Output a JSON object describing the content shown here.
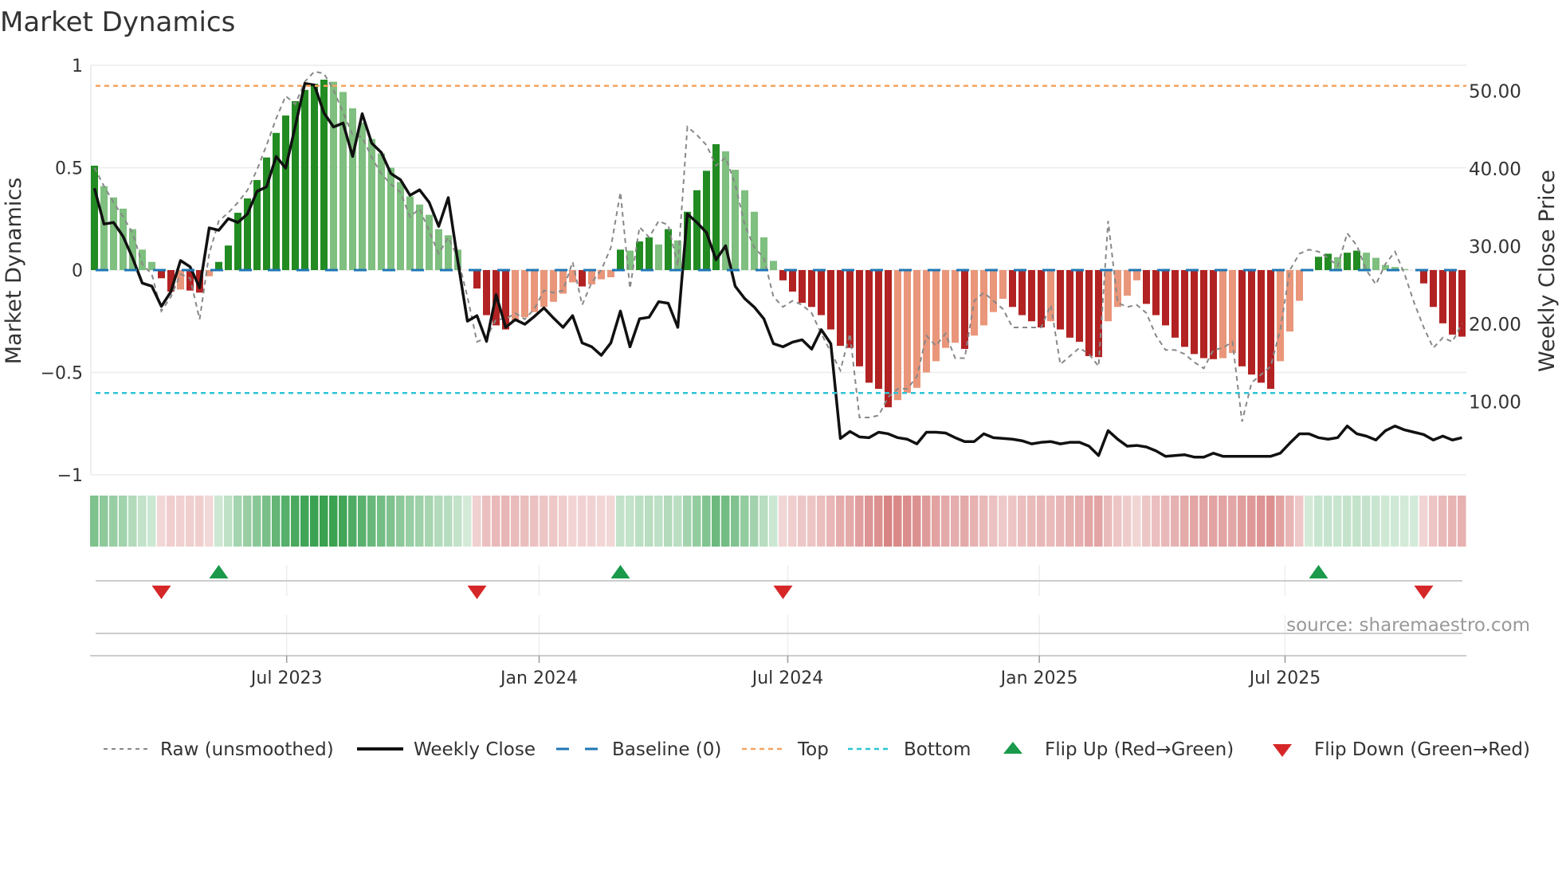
{
  "colors": {
    "pos_rising": "#228b22",
    "pos_falling": "#7fbf7f",
    "neg_falling": "#b22222",
    "neg_rising": "#e9967a",
    "close_line": "#111111",
    "raw_line": "#888888",
    "baseline": "#1f77b4",
    "top": "#f4a460",
    "bottom": "#2ec4d6",
    "flip_up": "#1a9a4a",
    "flip_down": "#d62728",
    "heat_green": "34,150,60",
    "heat_red": "200,80,80"
  },
  "chart_data": {
    "type": "bar",
    "title": "Market Dynamics",
    "ylabel": "Market Dynamics",
    "ylabel_right": "Weekly Close Price",
    "ylim": [
      -1,
      1
    ],
    "ylim_right_ref": [
      0,
      50
    ],
    "yticks": [
      {
        "value": 1,
        "label": "1"
      },
      {
        "value": 0.5,
        "label": "0.5"
      },
      {
        "value": 0,
        "label": "0"
      },
      {
        "value": -0.5,
        "label": "−0.5"
      },
      {
        "value": -1,
        "label": "−1"
      }
    ],
    "yticks_right": [
      {
        "value": 50,
        "label": "50.00"
      },
      {
        "value": 40,
        "label": "40.00"
      },
      {
        "value": 30,
        "label": "30.00"
      },
      {
        "value": 20,
        "label": "20.00"
      },
      {
        "value": 10,
        "label": "10.00"
      }
    ],
    "xticks": [
      {
        "week": 20.1,
        "label": "Jul 2023"
      },
      {
        "week": 46.5,
        "label": "Jan 2024"
      },
      {
        "week": 72.5,
        "label": "Jul 2024"
      },
      {
        "week": 98.8,
        "label": "Jan 2025"
      },
      {
        "week": 124.5,
        "label": "Jul 2025"
      }
    ],
    "top_level": 0.9,
    "bottom_level": -0.6,
    "baseline": 0,
    "grid": true,
    "legend_position": "bottom",
    "source": "source: sharemaestro.com",
    "dynamics": [
      0.51,
      0.41,
      0.355,
      0.3,
      0.2,
      0.1,
      0.04,
      -0.04,
      -0.105,
      -0.095,
      -0.1,
      -0.11,
      -0.03,
      0.04,
      0.12,
      0.28,
      0.35,
      0.44,
      0.55,
      0.67,
      0.755,
      0.825,
      0.88,
      0.91,
      0.93,
      0.92,
      0.87,
      0.79,
      0.72,
      0.64,
      0.57,
      0.5,
      0.43,
      0.36,
      0.32,
      0.27,
      0.2,
      0.17,
      0.1,
      0,
      -0.09,
      -0.22,
      -0.27,
      -0.29,
      -0.25,
      -0.23,
      -0.205,
      -0.18,
      -0.155,
      -0.115,
      -0.06,
      -0.08,
      -0.07,
      -0.045,
      -0.035,
      0.1,
      0.095,
      0.14,
      0.16,
      0.125,
      0.2,
      0.145,
      0.285,
      0.39,
      0.485,
      0.615,
      0.58,
      0.49,
      0.39,
      0.285,
      0.16,
      0.045,
      -0.05,
      -0.105,
      -0.16,
      -0.18,
      -0.22,
      -0.29,
      -0.37,
      -0.38,
      -0.47,
      -0.55,
      -0.58,
      -0.67,
      -0.635,
      -0.6,
      -0.575,
      -0.5,
      -0.445,
      -0.38,
      -0.355,
      -0.385,
      -0.32,
      -0.27,
      -0.205,
      -0.14,
      -0.18,
      -0.22,
      -0.25,
      -0.28,
      -0.25,
      -0.29,
      -0.33,
      -0.35,
      -0.42,
      -0.425,
      -0.25,
      -0.18,
      -0.125,
      -0.05,
      -0.165,
      -0.22,
      -0.27,
      -0.33,
      -0.375,
      -0.41,
      -0.43,
      -0.435,
      -0.43,
      -0.405,
      -0.47,
      -0.51,
      -0.55,
      -0.58,
      -0.445,
      -0.3,
      -0.15,
      0,
      0.065,
      0.08,
      0.063,
      0.085,
      0.095,
      0.085,
      0.06,
      0.025,
      0.015,
      0.005,
      0,
      -0.065,
      -0.18,
      -0.26,
      -0.315,
      -0.325
    ],
    "raw": [
      0.5,
      0.41,
      0.33,
      0.26,
      0.18,
      0.03,
      -0.02,
      -0.2,
      -0.13,
      -0.02,
      -0.04,
      -0.24,
      0.08,
      0.24,
      0.28,
      0.33,
      0.39,
      0.49,
      0.61,
      0.74,
      0.85,
      0.81,
      0.92,
      0.97,
      0.96,
      0.88,
      0.77,
      0.66,
      0.65,
      0.55,
      0.47,
      0.42,
      0.38,
      0.26,
      0.3,
      0.19,
      0.08,
      0.16,
      0.06,
      -0.13,
      -0.35,
      -0.33,
      -0.24,
      -0.24,
      -0.21,
      -0.24,
      -0.19,
      -0.1,
      -0.11,
      -0.1,
      0.04,
      -0.17,
      -0.06,
      0.0,
      0.11,
      0.38,
      -0.09,
      0.21,
      0.16,
      0.24,
      0.22,
      0.02,
      0.7,
      0.66,
      0.61,
      0.51,
      0.55,
      0.42,
      0.22,
      0.11,
      0.06,
      -0.13,
      -0.18,
      -0.15,
      -0.17,
      -0.21,
      -0.31,
      -0.4,
      -0.49,
      -0.31,
      -0.72,
      -0.72,
      -0.71,
      -0.62,
      -0.58,
      -0.58,
      -0.52,
      -0.32,
      -0.37,
      -0.31,
      -0.43,
      -0.43,
      -0.15,
      -0.11,
      -0.15,
      -0.19,
      -0.28,
      -0.28,
      -0.28,
      -0.28,
      -0.17,
      -0.46,
      -0.42,
      -0.38,
      -0.41,
      -0.47,
      0.24,
      -0.16,
      -0.18,
      -0.17,
      -0.21,
      -0.32,
      -0.39,
      -0.39,
      -0.41,
      -0.45,
      -0.48,
      -0.39,
      -0.38,
      -0.35,
      -0.74,
      -0.55,
      -0.51,
      -0.47,
      -0.29,
      0.0,
      0.08,
      0.1,
      0.09,
      0.06,
      0.02,
      0.18,
      0.12,
      0.0,
      -0.07,
      0.03,
      0.09,
      -0.02,
      -0.16,
      -0.28,
      -0.38,
      -0.33,
      -0.35,
      -0.26
    ],
    "weekly_close": [
      37.4,
      32.8,
      33.0,
      31.2,
      28.4,
      25.2,
      24.8,
      22.2,
      24.1,
      28.1,
      27.3,
      24.6,
      32.3,
      32.0,
      33.5,
      33.0,
      34.1,
      37.0,
      37.6,
      41.5,
      40.0,
      45.4,
      50.9,
      50.7,
      47.1,
      45.3,
      45.8,
      41.5,
      47.0,
      43.2,
      42.0,
      39.3,
      38.5,
      36.5,
      37.2,
      35.6,
      32.5,
      36.2,
      28.0,
      20.3,
      21.0,
      17.7,
      23.7,
      19.5,
      20.5,
      19.9,
      20.9,
      22.0,
      20.7,
      19.5,
      21.0,
      17.5,
      17.0,
      15.9,
      17.5,
      21.6,
      17.0,
      20.6,
      20.8,
      22.8,
      22.6,
      19.5,
      34.1,
      33.0,
      31.7,
      28.2,
      30.0,
      24.8,
      23.2,
      22.1,
      20.6,
      17.4,
      17.0,
      17.6,
      17.9,
      16.7,
      19.2,
      17.4,
      5.2,
      6.1,
      5.4,
      5.3,
      6.0,
      5.8,
      5.3,
      5.1,
      4.5,
      6.0,
      6.0,
      5.9,
      5.3,
      4.8,
      4.8,
      5.8,
      5.3,
      5.2,
      5.1,
      4.9,
      4.5,
      4.7,
      4.8,
      4.5,
      4.7,
      4.7,
      4.2,
      3.0,
      6.2,
      5.1,
      4.2,
      4.3,
      4.1,
      3.6,
      2.9,
      3.0,
      3.1,
      2.8,
      2.8,
      3.3,
      2.9,
      2.9,
      2.9,
      2.9,
      2.9,
      2.9,
      3.3,
      4.6,
      5.8,
      5.8,
      5.3,
      5.1,
      5.3,
      6.8,
      5.8,
      5.5,
      5.0,
      6.2,
      6.8,
      6.3,
      6.0,
      5.7,
      5.0,
      5.5,
      5.0,
      5.3
    ]
  },
  "legend": {
    "raw": "Raw (unsmoothed)",
    "close": "Weekly Close",
    "baseline": "Baseline (0)",
    "top": "Top",
    "bottom": "Bottom",
    "flip_up": "Flip Up (Red→Green)",
    "flip_down": "Flip Down (Green→Red)"
  }
}
